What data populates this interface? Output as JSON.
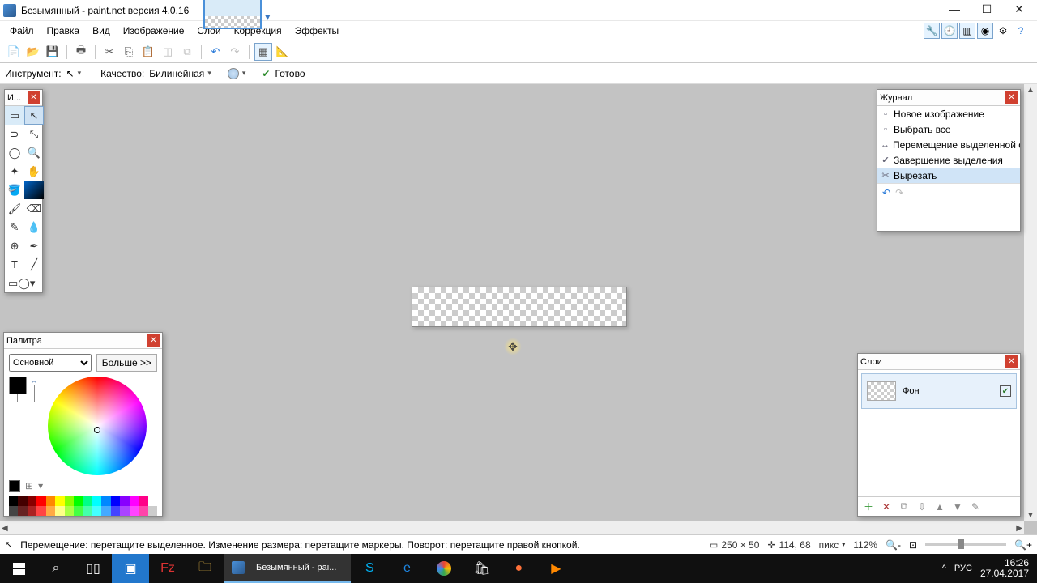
{
  "title": "Безымянный - paint.net версия 4.0.16",
  "menu": [
    "Файл",
    "Правка",
    "Вид",
    "Изображение",
    "Слои",
    "Коррекция",
    "Эффекты"
  ],
  "options": {
    "tool_label": "Инструмент:",
    "quality_label": "Качество:",
    "quality_value": "Билинейная",
    "ready": "Готово"
  },
  "tools_panel": {
    "title": "И..."
  },
  "palette": {
    "title": "Палитра",
    "mode": "Основной",
    "more": "Больше >>"
  },
  "history": {
    "title": "Журнал",
    "items": [
      {
        "icon": "▫",
        "label": "Новое изображение"
      },
      {
        "icon": "▫",
        "label": "Выбрать все"
      },
      {
        "icon": "↔",
        "label": "Перемещение выделенной области"
      },
      {
        "icon": "✔",
        "label": "Завершение выделения"
      },
      {
        "icon": "✂",
        "label": "Вырезать"
      }
    ]
  },
  "layers": {
    "title": "Слои",
    "row": {
      "name": "Фон"
    }
  },
  "status": {
    "hint": "Перемещение: перетащите выделенное. Изменение размера: перетащите маркеры. Поворот: перетащите правой кнопкой.",
    "canvas_size": "250 × 50",
    "cursor_pos": "114, 68",
    "unit": "пикс",
    "zoom": "112%"
  },
  "taskbar": {
    "app_label": "Безымянный - pai...",
    "tray": {
      "up": "^",
      "lang": "РУС",
      "time": "16:26",
      "date": "27.04.2017"
    }
  }
}
